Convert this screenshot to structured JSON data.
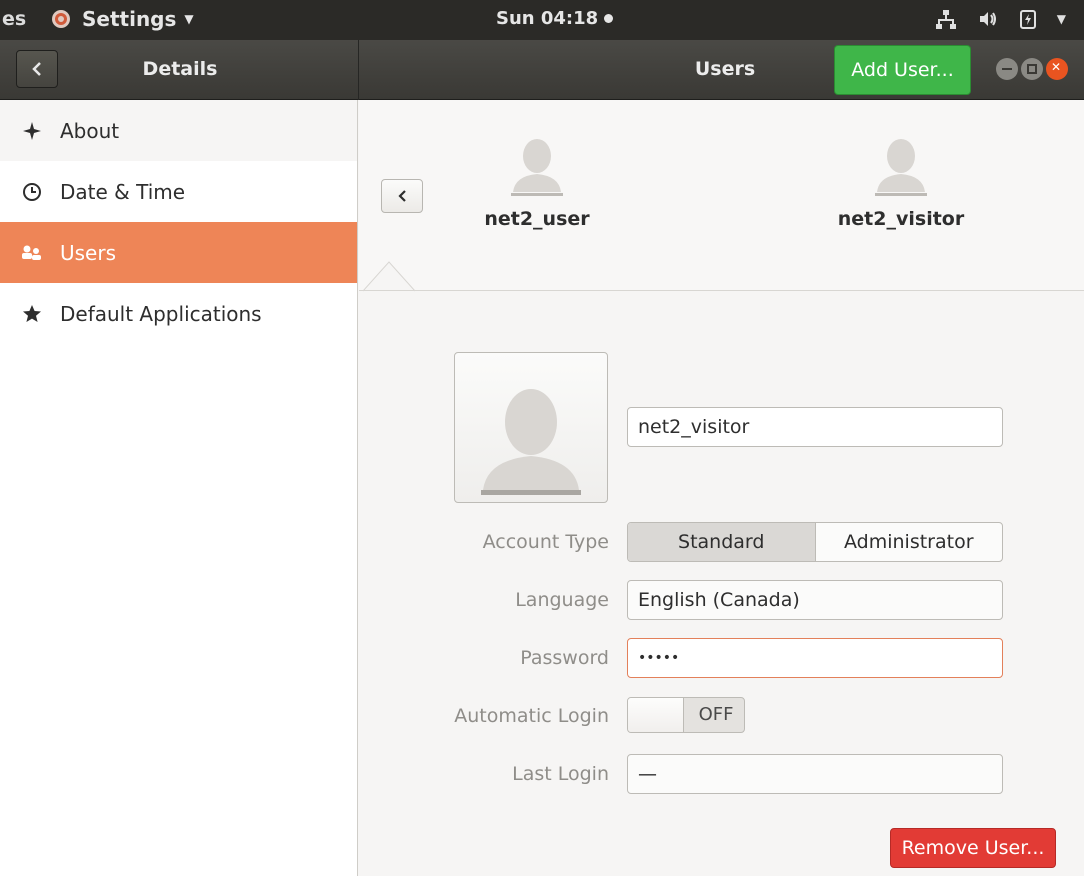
{
  "top_panel": {
    "activities_cut": "es",
    "app_menu_label": "Settings",
    "clock": "Sun 04:18"
  },
  "header": {
    "back_button_icon": "chevron-left",
    "panel_title": "Details",
    "page_title": "Users",
    "add_user_label": "Add User..."
  },
  "sidebar": {
    "items": [
      {
        "label": "About",
        "icon": "sparkle-icon"
      },
      {
        "label": "Date & Time",
        "icon": "clock-icon"
      },
      {
        "label": "Users",
        "icon": "users-icon",
        "active": true
      },
      {
        "label": "Default Applications",
        "icon": "star-icon"
      }
    ]
  },
  "users_carousel": {
    "users": [
      {
        "name": "net2_user"
      },
      {
        "name": "net2_visitor"
      }
    ]
  },
  "account": {
    "full_name": "net2_visitor",
    "account_type_label": "Account Type",
    "account_type_options": [
      "Standard",
      "Administrator"
    ],
    "account_type_selected": "Standard",
    "language_label": "Language",
    "language_value": "English (Canada)",
    "password_label": "Password",
    "password_value": "•••••",
    "auto_login_label": "Automatic Login",
    "auto_login_state": "OFF",
    "last_login_label": "Last Login",
    "last_login_value": "—",
    "remove_user_label": "Remove User..."
  },
  "colors": {
    "accent_orange": "#ee8557",
    "add_green": "#3fb649",
    "remove_red": "#e23b35",
    "close_orange": "#e95420"
  }
}
